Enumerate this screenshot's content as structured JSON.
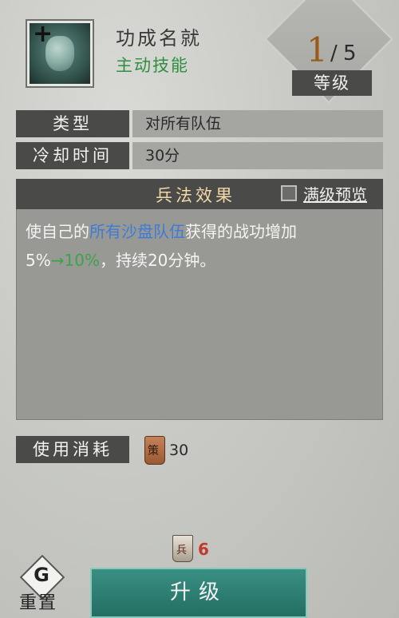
{
  "skill": {
    "name": "功成名就",
    "type": "主动技能",
    "icon_badge": "+",
    "icon_name": "jade-pendant-icon"
  },
  "level": {
    "current": "1",
    "separator": "/",
    "max": "5",
    "label": "等级"
  },
  "rows": {
    "type_label": "类型",
    "type_value": "对所有队伍",
    "cooldown_label": "冷却时间",
    "cooldown_value": "30分"
  },
  "effect": {
    "title": "兵法效果",
    "preview_label": "满级预览",
    "text_part1": "使自己的",
    "text_highlight": "所有沙盘队伍",
    "text_part2": "获得的战功增加",
    "text_part3": "5%",
    "text_upgrade": "→10%",
    "text_part4": "，持续20分钟。"
  },
  "cost": {
    "label": "使用消耗",
    "token_glyph": "策",
    "value": "30"
  },
  "footer": {
    "soldier_glyph": "兵",
    "soldier_count": "6",
    "upgrade_label": "升级",
    "reset_glyph": "G",
    "reset_label": "重置"
  },
  "colors": {
    "accent_green": "#2f8f3e",
    "highlight_blue": "#3d7bd8",
    "level_orange": "#9a5a18",
    "button_teal": "#236e63"
  }
}
